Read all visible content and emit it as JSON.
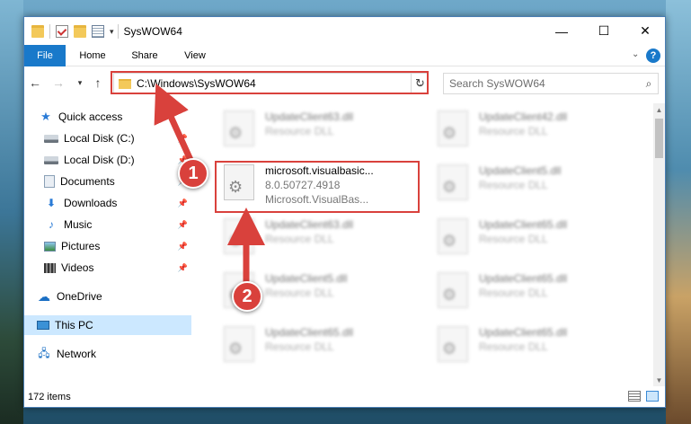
{
  "window": {
    "title": "SysWOW64",
    "controls": {
      "minimize": "—",
      "maximize": "☐",
      "close": "✕"
    }
  },
  "ribbon": {
    "tabs": [
      "File",
      "Home",
      "Share",
      "View"
    ],
    "help_label": "?"
  },
  "navigation": {
    "address": "C:\\Windows\\SysWOW64",
    "search_placeholder": "Search SysWOW64"
  },
  "sidebar": {
    "items": [
      {
        "label": "Quick access",
        "icon": "star-icon"
      },
      {
        "label": "Local Disk (C:)",
        "icon": "disk-icon",
        "pinned": true
      },
      {
        "label": "Local Disk (D:)",
        "icon": "disk-icon",
        "pinned": true
      },
      {
        "label": "Documents",
        "icon": "documents-icon",
        "pinned": true
      },
      {
        "label": "Downloads",
        "icon": "download-icon",
        "pinned": true
      },
      {
        "label": "Music",
        "icon": "music-icon",
        "pinned": true
      },
      {
        "label": "Pictures",
        "icon": "pictures-icon",
        "pinned": true
      },
      {
        "label": "Videos",
        "icon": "videos-icon",
        "pinned": true
      },
      {
        "label": "OneDrive",
        "icon": "onedrive-icon"
      },
      {
        "label": "This PC",
        "icon": "pc-icon",
        "selected": true
      },
      {
        "label": "Network",
        "icon": "network-icon"
      }
    ]
  },
  "files": [
    {
      "name": "UpdateClient63.dll",
      "type": "Resource DLL"
    },
    {
      "name": "UpdateClient42.dll",
      "type": "Resource DLL"
    },
    {
      "name": "microsoft.visualbasic...",
      "version": "8.0.50727.4918",
      "description": "Microsoft.VisualBas..."
    },
    {
      "name": "UpdateClient5.dll",
      "type": "Resource DLL"
    },
    {
      "name": "UpdateClient63.dll",
      "type": "Resource DLL"
    },
    {
      "name": "UpdateClient65.dll",
      "type": "Resource DLL"
    },
    {
      "name": "UpdateClient5.dll",
      "type": "Resource DLL"
    },
    {
      "name": "UpdateClient65.dll",
      "type": "Resource DLL"
    },
    {
      "name": "UpdateClient65.dll",
      "type": "Resource DLL"
    },
    {
      "name": "UpdateClient65.dll",
      "type": "Resource DLL"
    }
  ],
  "status": {
    "item_count": "172 items"
  },
  "annotations": {
    "step1": "1",
    "step2": "2",
    "color": "#d9413c"
  }
}
